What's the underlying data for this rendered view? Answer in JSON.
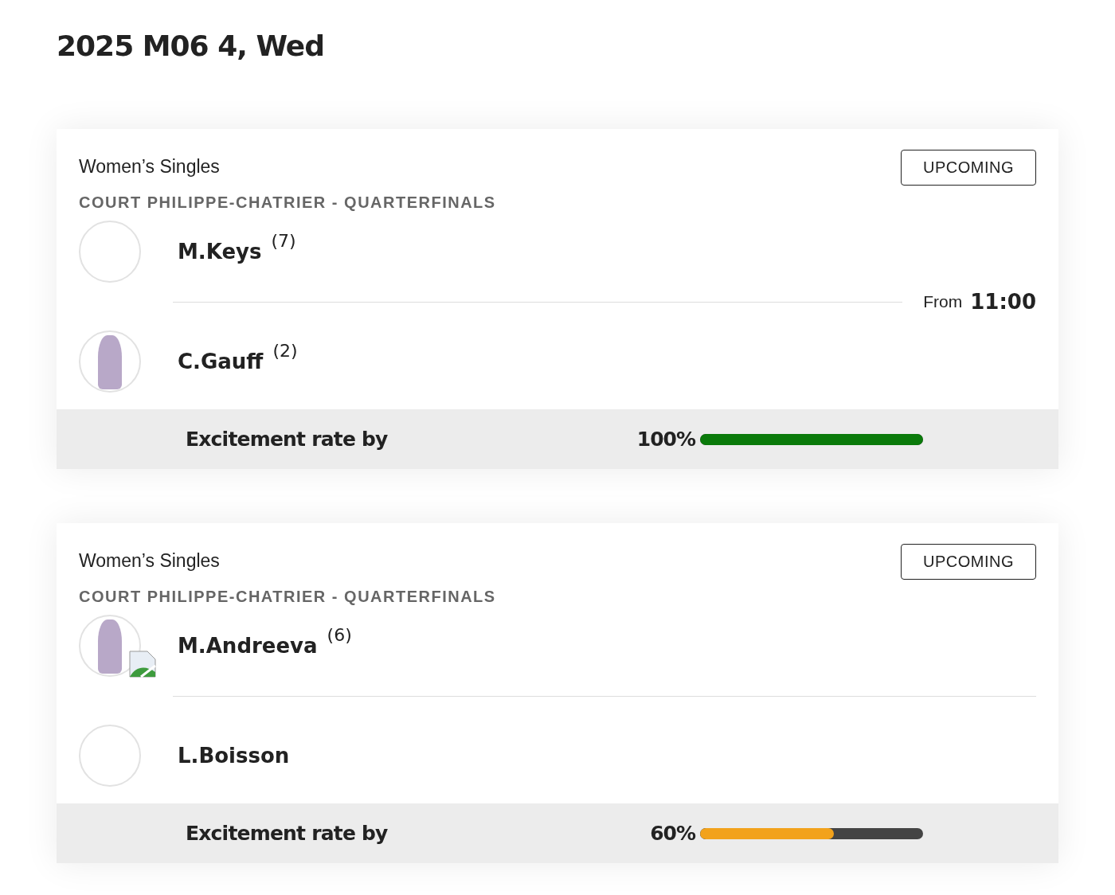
{
  "date_heading": "2025 M06 4, Wed",
  "matches": [
    {
      "event": "Women’s Singles",
      "status": "UPCOMING",
      "round": "COURT PHILIPPE-CHATRIER - QUARTERFINALS",
      "players": [
        {
          "name": "M.Keys",
          "seed": "(7)",
          "photo": false,
          "broken_image": false
        },
        {
          "name": "C.Gauff",
          "seed": "(2)",
          "photo": true,
          "broken_image": false
        }
      ],
      "time_label": "From",
      "time": "11:00",
      "excitement_label": "Excitement rate by",
      "excitement_reading": "100%",
      "level": 1,
      "color": "#0a7a0a"
    },
    {
      "event": "Women’s Singles",
      "status": "UPCOMING",
      "round": "COURT PHILIPPE-CHATRIER - QUARTERFINALS",
      "players": [
        {
          "name": "M.Andreeva",
          "seed": "(6)",
          "photo": true,
          "broken_image": true
        },
        {
          "name": "L.Boisson",
          "photo": false,
          "broken_image": false
        }
      ],
      "excitement_label": "Excitement rate by",
      "excitement_reading": "60%",
      "level": 0.6,
      "color": "#f2a21b"
    }
  ]
}
